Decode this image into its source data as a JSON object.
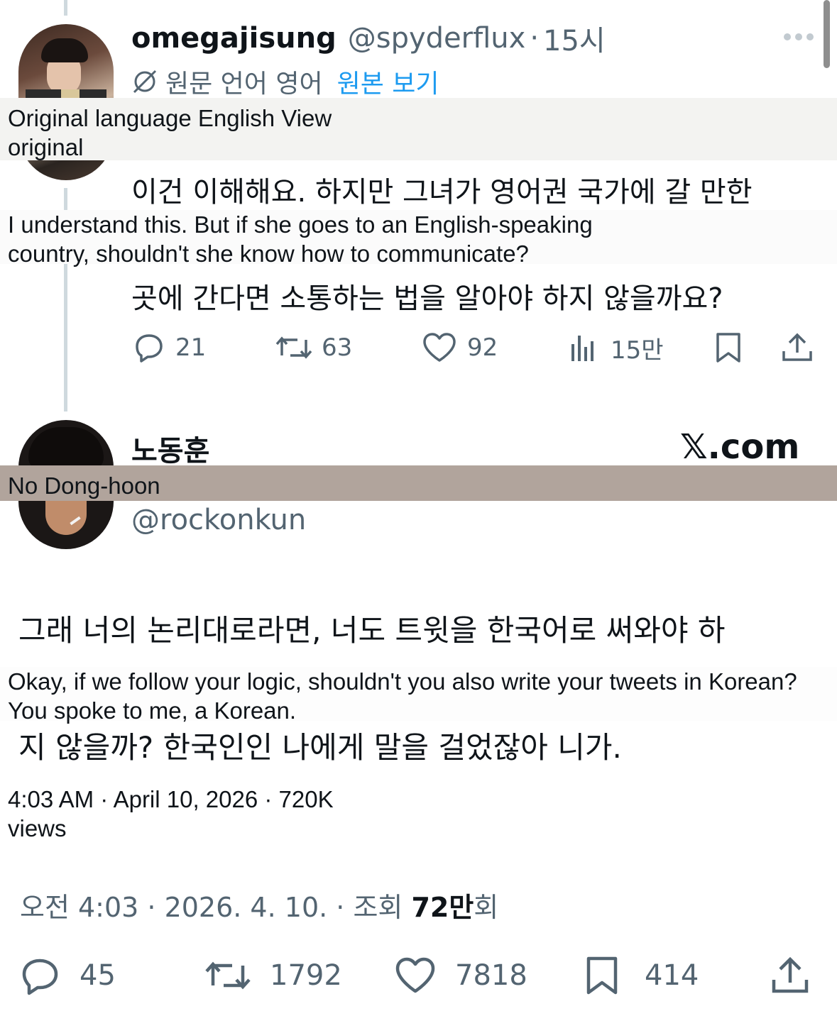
{
  "first_tweet": {
    "display_name": "omegajisung",
    "handle": "@spyderflux",
    "separator": "·",
    "time": "15시",
    "more_label": "···",
    "translate_notice": "원문 언어 영어",
    "view_original_link": "원본 보기",
    "text_line1": "이건 이해해요. 하지만 그녀가 영어권 국가에 갈 만한",
    "text_line2": "곳에 간다면 소통하는 법을 알아야 하지 않을까요?",
    "overlay_notice": "Original language English View original",
    "overlay_text": "I understand this. But if she goes to an English-speaking country, shouldn't she know how to communicate?",
    "actions": {
      "replies": "21",
      "reposts": "63",
      "likes": "92",
      "views": "15만"
    }
  },
  "second_tweet": {
    "display_name": "노동훈",
    "overlay_name": "No Dong-hoon",
    "handle": "@rockonkun",
    "watermark": "𝕏.com",
    "text_line1": "그래 너의 논리대로라면, 너도 트윗을 한국어로 써와야 하",
    "text_line2": "지 않을까? 한국인인 나에게 말을 걸었잖아 니가.",
    "overlay_text": "Okay, if we follow your logic, shouldn't you also write your tweets in Korean? You spoke to me, a Korean.",
    "overlay_meta": "4:03 AM · April 10, 2026 · 720K views",
    "meta_prefix": "오전 4:03 · 2026. 4. 10. · 조회 ",
    "meta_bold": "72만",
    "meta_suffix": "회",
    "actions": {
      "replies": "45",
      "reposts": "1792",
      "likes": "7818",
      "bookmarks": "414"
    }
  },
  "colors": {
    "text": "#0f1419",
    "secondary": "#536471",
    "link": "#1d9bf0",
    "overlay_gray": "#f3f3f1",
    "overlay_brown": "#b1a49c"
  }
}
